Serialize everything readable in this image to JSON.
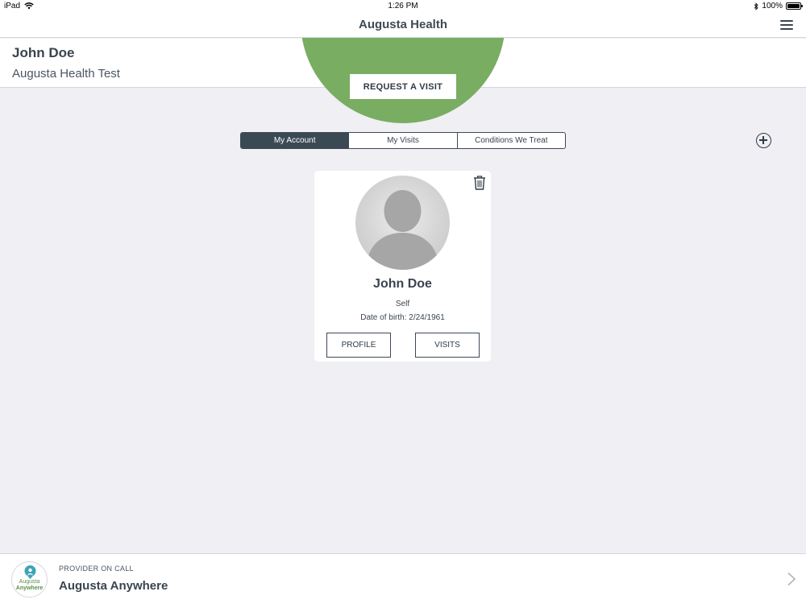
{
  "status_bar": {
    "device": "iPad",
    "time": "1:26 PM",
    "battery": "100%"
  },
  "nav": {
    "title": "Augusta Health"
  },
  "user": {
    "name": "John Doe",
    "organization": "Augusta Health Test"
  },
  "request_button": "REQUEST A VISIT",
  "tabs": [
    {
      "label": "My Account",
      "active": true
    },
    {
      "label": "My Visits",
      "active": false
    },
    {
      "label": "Conditions We Treat",
      "active": false
    }
  ],
  "patient_card": {
    "name": "John Doe",
    "relationship": "Self",
    "dob": "Date of birth: 2/24/1961",
    "profile_button": "PROFILE",
    "visits_button": "VISITS"
  },
  "provider_bar": {
    "label": "PROVIDER ON CALL",
    "title": "Augusta Anywhere",
    "logo_text_1": "Augusta",
    "logo_text_2": "Anywhere"
  },
  "colors": {
    "brand_green": "#79ad62",
    "dark_slate": "#3b4955",
    "background": "#efeff4"
  },
  "icons": [
    "wifi-icon",
    "bluetooth-icon",
    "battery-icon",
    "hamburger-menu-icon",
    "add-circle-icon",
    "trash-icon",
    "avatar-placeholder-icon",
    "chevron-right-icon",
    "location-pin-icon"
  ]
}
